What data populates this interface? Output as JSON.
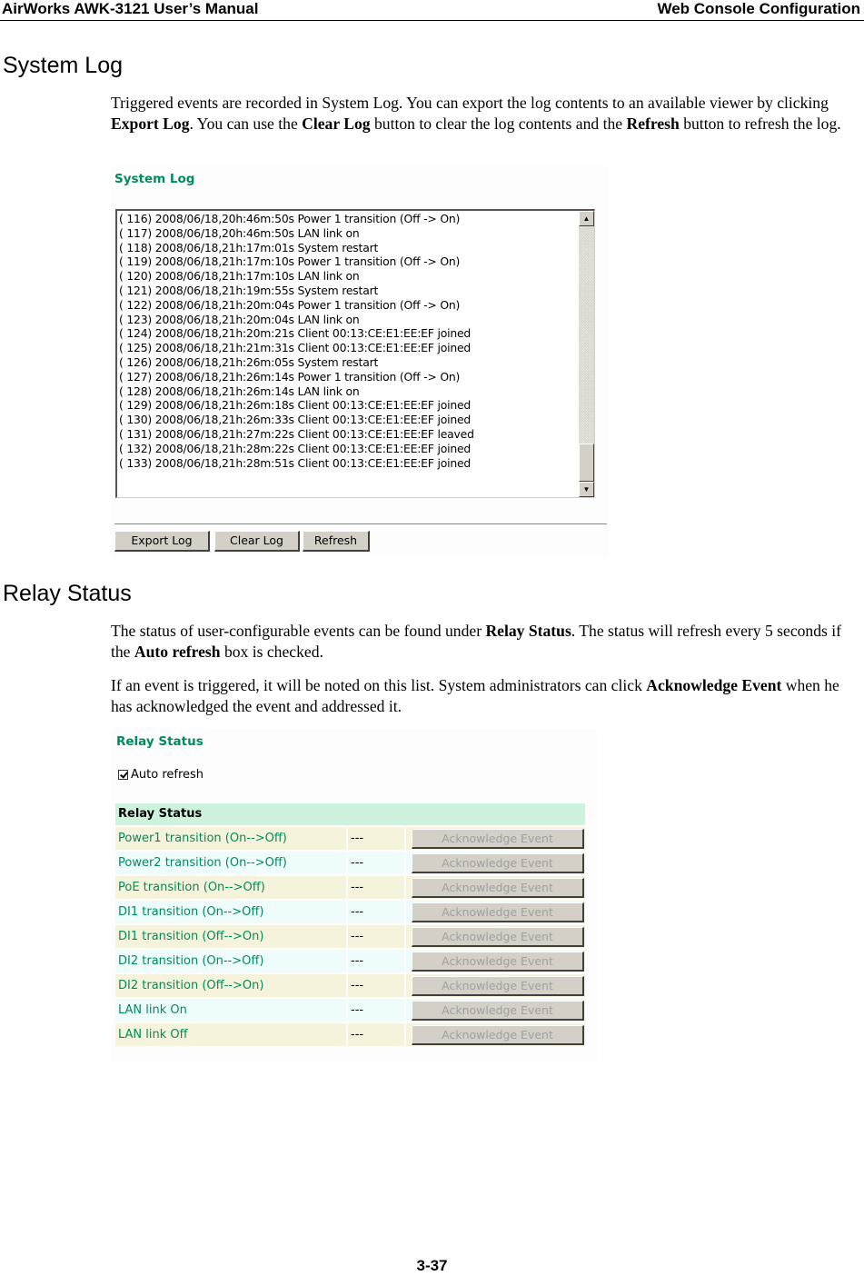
{
  "header": {
    "left": "AirWorks AWK-3121 User’s Manual",
    "right": "Web Console Configuration"
  },
  "system_log": {
    "heading": "System Log",
    "para": {
      "t1": "Triggered events are recorded in System Log. You can export the log contents to an available viewer by clicking ",
      "b1": "Export Log",
      "t2": ". You can use the ",
      "b2": "Clear Log",
      "t3": " button to clear the log contents and the ",
      "b3": "Refresh",
      "t4": " button to refresh the log."
    },
    "screenshot": {
      "title": "System Log",
      "log_lines": [
        "( 116) 2008/06/18,20h:46m:50s Power 1 transition (Off -> On)",
        "( 117) 2008/06/18,20h:46m:50s LAN link on",
        "( 118) 2008/06/18,21h:17m:01s System restart",
        "( 119) 2008/06/18,21h:17m:10s Power 1 transition (Off -> On)",
        "( 120) 2008/06/18,21h:17m:10s LAN link on",
        "( 121) 2008/06/18,21h:19m:55s System restart",
        "( 122) 2008/06/18,21h:20m:04s Power 1 transition (Off -> On)",
        "( 123) 2008/06/18,21h:20m:04s LAN link on",
        "( 124) 2008/06/18,21h:20m:21s Client 00:13:CE:E1:EE:EF joined",
        "( 125) 2008/06/18,21h:21m:31s Client 00:13:CE:E1:EE:EF joined",
        "( 126) 2008/06/18,21h:26m:05s System restart",
        "( 127) 2008/06/18,21h:26m:14s Power 1 transition (Off -> On)",
        "( 128) 2008/06/18,21h:26m:14s LAN link on",
        "( 129) 2008/06/18,21h:26m:18s Client 00:13:CE:E1:EE:EF joined",
        "( 130) 2008/06/18,21h:26m:33s Client 00:13:CE:E1:EE:EF joined",
        "( 131) 2008/06/18,21h:27m:22s Client 00:13:CE:E1:EE:EF leaved",
        "( 132) 2008/06/18,21h:28m:22s Client 00:13:CE:E1:EE:EF joined",
        "( 133) 2008/06/18,21h:28m:51s Client 00:13:CE:E1:EE:EF joined"
      ],
      "scrollbar": {
        "up_icon": "▲",
        "down_icon": "▼"
      },
      "buttons": {
        "export": "Export Log",
        "clear": "Clear Log",
        "refresh": "Refresh"
      }
    }
  },
  "relay_status": {
    "heading": "Relay Status",
    "para1": {
      "t1": "The status of user-configurable events can be found under ",
      "b1": "Relay Status",
      "t2": ". The status will refresh every 5 seconds if the ",
      "b2": "Auto refresh",
      "t3": " box is checked."
    },
    "para2": {
      "t1": "If an event is triggered, it will be noted on this list. System administrators can click ",
      "b1": "Acknowledge Event",
      "t2": " when he has acknowledged the event and addressed it."
    },
    "screenshot": {
      "title": "Relay Status",
      "auto_refresh": {
        "label": "Auto refresh",
        "checked": true
      },
      "table_header": "Relay Status",
      "rows": [
        {
          "event": "Power1 transition (On-->Off)",
          "status": "---",
          "button": "Acknowledge Event"
        },
        {
          "event": "Power2 transition (On-->Off)",
          "status": "---",
          "button": "Acknowledge Event"
        },
        {
          "event": "PoE transition (On-->Off)",
          "status": "---",
          "button": "Acknowledge Event"
        },
        {
          "event": "DI1 transition (On-->Off)",
          "status": "---",
          "button": "Acknowledge Event"
        },
        {
          "event": "DI1 transition (Off-->On)",
          "status": "---",
          "button": "Acknowledge Event"
        },
        {
          "event": "DI2 transition (On-->Off)",
          "status": "---",
          "button": "Acknowledge Event"
        },
        {
          "event": "DI2 transition (Off-->On)",
          "status": "---",
          "button": "Acknowledge Event"
        },
        {
          "event": "LAN link On",
          "status": "---",
          "button": "Acknowledge Event"
        },
        {
          "event": "LAN link Off",
          "status": "---",
          "button": "Acknowledge Event"
        }
      ]
    }
  },
  "footer": {
    "page_number": "3-37"
  },
  "colors": {
    "accent_green": "#008c5a",
    "table_header_bg": "#cdf2de",
    "row_odd_bg": "#f5f3dc",
    "row_even_bg": "#eefcfc",
    "button_face": "#d4d0c8",
    "disabled_text": "#a0a0a0"
  }
}
